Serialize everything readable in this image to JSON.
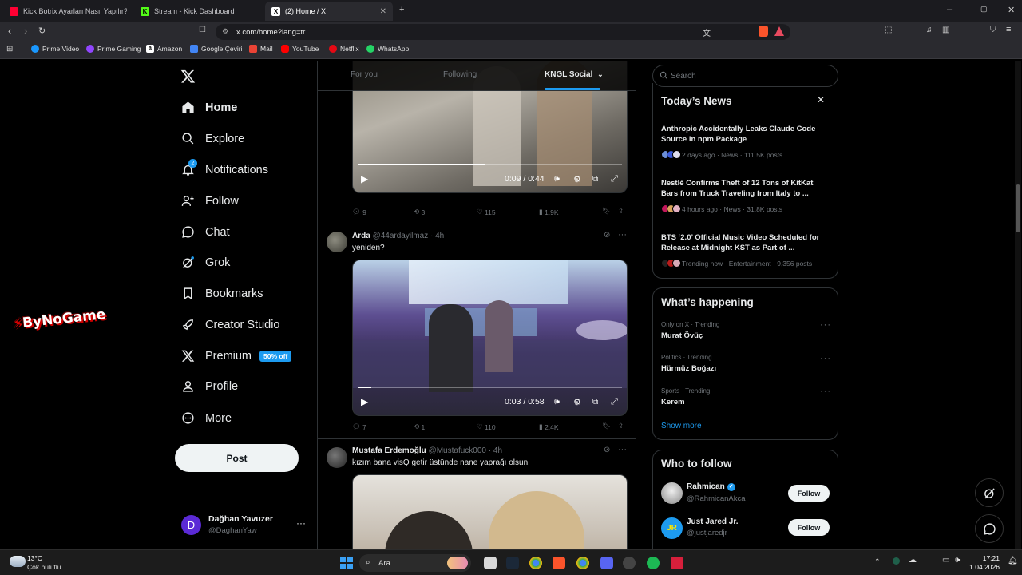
{
  "browser": {
    "tabs": [
      {
        "title": "Kick Botrix Ayarları Nasıl Yapılır? Takip...",
        "color": "#ff0033"
      },
      {
        "title": "Stream - Kick Dashboard",
        "color": "#53fc18"
      },
      {
        "title": "(2) Home / X",
        "color": "#000000"
      }
    ],
    "url": "x.com/home?lang=tr",
    "bookmarks": [
      "Prime Video",
      "Prime Gaming",
      "Amazon",
      "Google Çeviri",
      "Mail",
      "YouTube",
      "Netflix",
      "WhatsApp"
    ]
  },
  "overlay": {
    "logo_text": "ByNoGame"
  },
  "sidebar": {
    "items": [
      {
        "label": "Home",
        "icon": "home-icon"
      },
      {
        "label": "Explore",
        "icon": "search-icon"
      },
      {
        "label": "Notifications",
        "icon": "bell-icon",
        "badge": "2"
      },
      {
        "label": "Follow",
        "icon": "add-user-icon"
      },
      {
        "label": "Chat",
        "icon": "chat-icon"
      },
      {
        "label": "Grok",
        "icon": "grok-icon"
      },
      {
        "label": "Bookmarks",
        "icon": "bookmark-icon"
      },
      {
        "label": "Creator Studio",
        "icon": "rocket-icon"
      },
      {
        "label": "Premium",
        "icon": "x-logo-icon",
        "badge": "50% off"
      },
      {
        "label": "Profile",
        "icon": "person-icon"
      },
      {
        "label": "More",
        "icon": "more-circle-icon"
      }
    ],
    "post_label": "Post",
    "account": {
      "name": "Dağhan Yavuzer",
      "handle": "@DaghanYaw",
      "initial": "D"
    }
  },
  "feed": {
    "tabs": [
      "For you",
      "Following",
      "KNGL Social"
    ],
    "posts": [
      {
        "video_time": "0:09 / 0:44",
        "progress": 0.48,
        "stats": {
          "replies": "9",
          "reposts": "3",
          "likes": "115",
          "views": "1.9K"
        }
      },
      {
        "name": "Arda",
        "handle": "@44ardayilmaz",
        "age": "· 4h",
        "text": "yeniden?",
        "video_time": "0:03 / 0:58",
        "progress": 0.05,
        "stats": {
          "replies": "7",
          "reposts": "1",
          "likes": "110",
          "views": "2.4K"
        }
      },
      {
        "name": "Mustafa Erdemoğlu",
        "handle": "@Mustafuck000",
        "age": "· 4h",
        "text": "kızım bana visQ getir üstünde nane yaprağı olsun"
      }
    ]
  },
  "right": {
    "search_placeholder": "Search",
    "news": {
      "title": "Today’s News",
      "items": [
        {
          "title": "Anthropic Accidentally Leaks Claude Code Source in npm Package",
          "meta": "2 days ago · News · 111.5K posts"
        },
        {
          "title": "Nestlé Confirms Theft of 12 Tons of KitKat Bars from Truck Traveling from Italy to ...",
          "meta": "4 hours ago · News · 31.8K posts"
        },
        {
          "title": "BTS ‘2.0’ Official Music Video Scheduled for Release at Midnight KST as Part of ...",
          "meta": "Trending now · Entertainment · 9,356 posts"
        }
      ]
    },
    "happening": {
      "title": "What’s happening",
      "items": [
        {
          "context": "Only on X · Trending",
          "name": "Murat Övüç"
        },
        {
          "context": "Politics · Trending",
          "name": "Hürmüz Boğazı"
        },
        {
          "context": "Sports · Trending",
          "name": "Kerem"
        }
      ],
      "show_more": "Show more"
    },
    "who_to_follow": {
      "title": "Who to follow",
      "follow_label": "Follow",
      "users": [
        {
          "name": "Rahmican",
          "handle": "@RahmicanAkca",
          "verified": true
        },
        {
          "name": "Just Jared Jr.",
          "handle": "@justjaredjr"
        }
      ]
    }
  },
  "taskbar": {
    "weather_temp": "13°C",
    "weather_desc": "Çok bulutlu",
    "search_label": "Ara",
    "time": "17:21",
    "date": "1.04.2026"
  },
  "colors": {
    "accent": "#1d9bf0",
    "bg": "#000000",
    "border": "#2f3336",
    "muted": "#71767b"
  }
}
